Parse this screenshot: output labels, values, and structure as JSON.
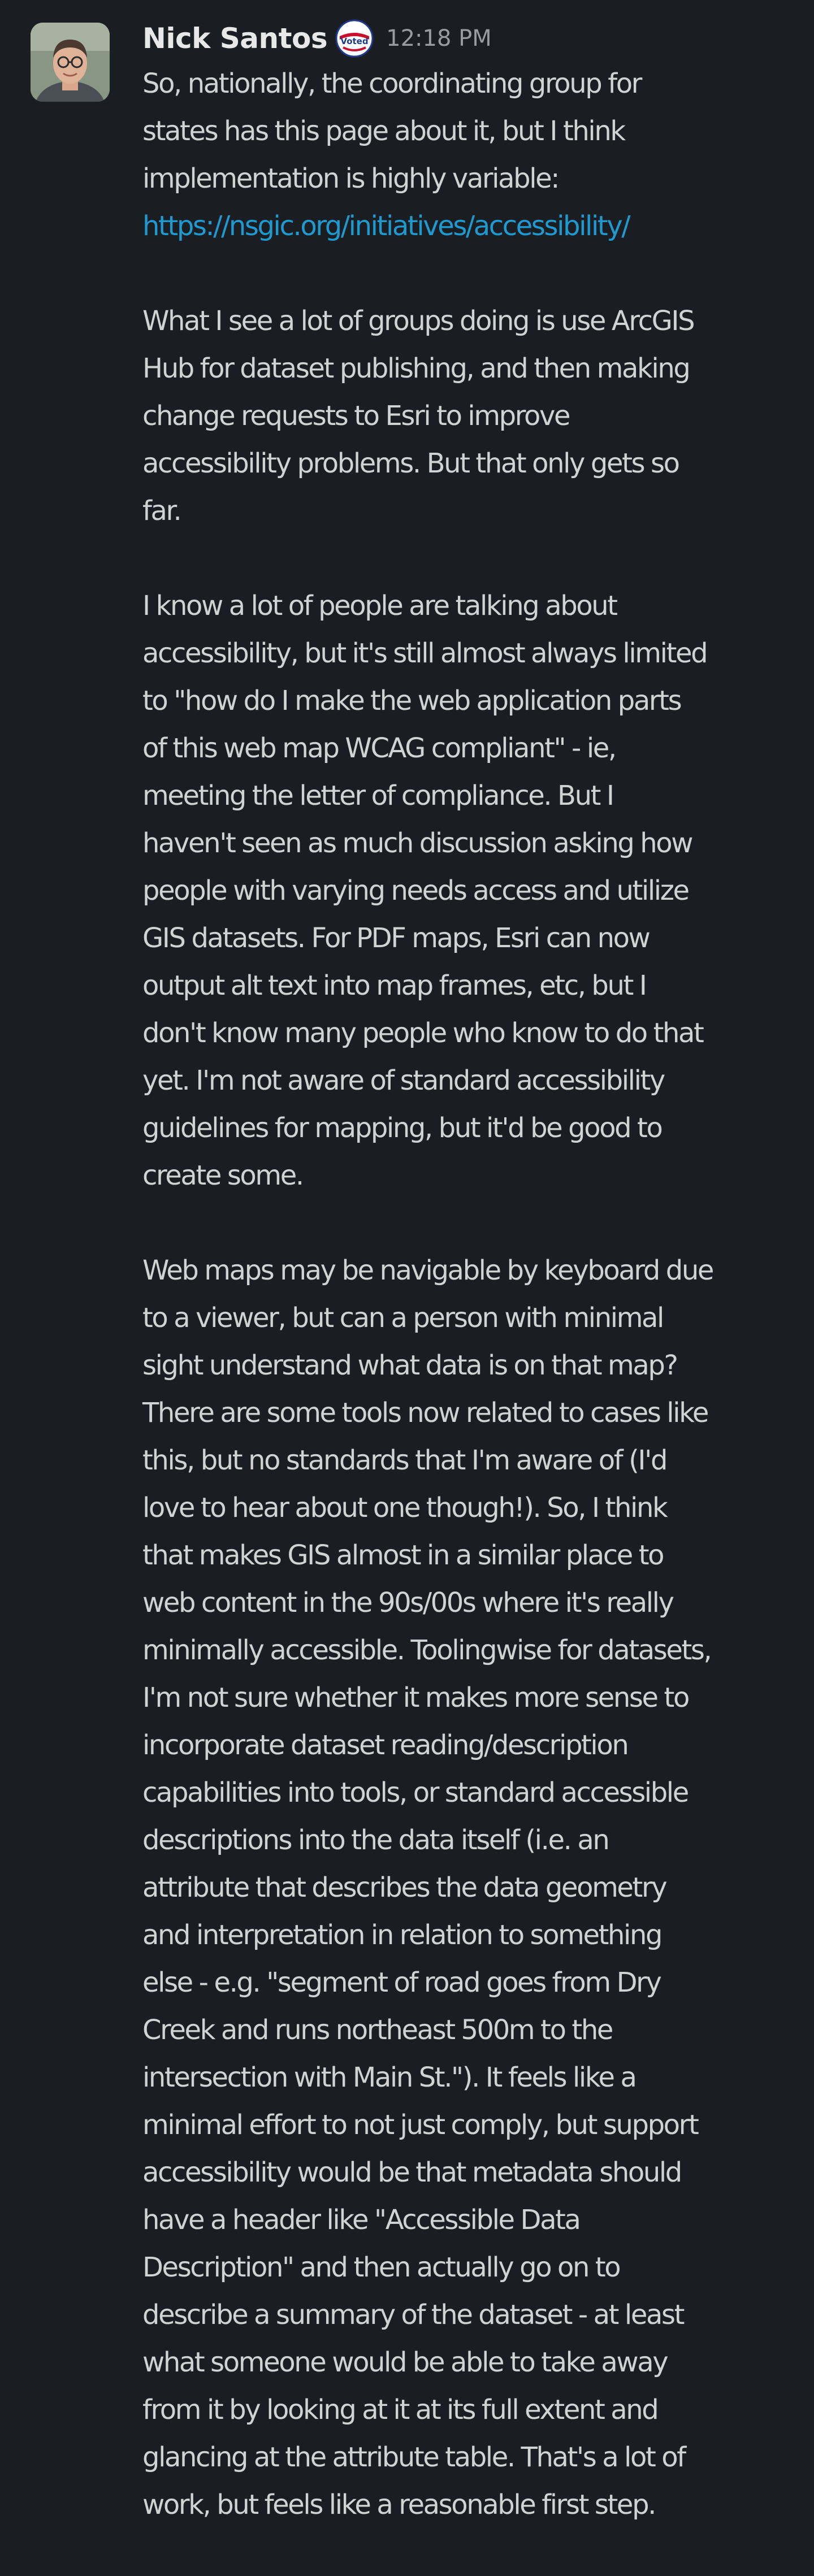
{
  "message": {
    "sender": "Nick Santos",
    "status_emoji": "voted-sticker-icon",
    "status_emoji_text": "Voted",
    "timestamp": "12:18 PM",
    "paragraph1_before_link": "So, nationally, the coordinating group for\nstates has this page about it, but I think\nimplementation is highly variable:",
    "link_text": "https://nsgic.org/initiatives/accessibility/",
    "paragraph2": "What I see a lot of groups doing is use ArcGIS\nHub for dataset publishing, and then making\nchange requests to Esri to improve\naccessibility problems. But that only gets so\nfar.",
    "paragraph3": "I know a lot of people are talking about\naccessibility, but it's still almost always limited\nto \"how do I make the web application parts\nof this web map WCAG compliant\" - ie,\nmeeting the letter of compliance. But I\nhaven't seen as much discussion asking how\npeople with varying needs access and utilize\nGIS datasets. For PDF maps, Esri can now\noutput alt text into map frames, etc, but I\ndon't know many people who know to do that\nyet. I'm not aware of standard accessibility\nguidelines for mapping, but it'd be good to\ncreate some.",
    "paragraph4": "Web maps may be navigable by keyboard due\nto a viewer, but can a person with minimal\nsight understand what data is on that map?\nThere are some tools now related to cases like\nthis, but no standards that I'm aware of (I'd\nlove to hear about one though!). So, I think\nthat makes GIS almost in a similar place to\nweb content in the 90s/00s where it's really\nminimally accessible. Toolingwise for datasets,\nI'm not sure whether it makes more sense to\nincorporate dataset reading/description\ncapabilities into tools, or standard accessible\ndescriptions into the data itself (i.e. an\nattribute that describes the data geometry\nand interpretation in relation to something\nelse - e.g. \"segment of road goes from Dry\nCreek and runs northeast 500m to the\nintersection with Main St.\"). It feels like a\nminimal effort to not just comply, but support\naccessibility would be that metadata should\nhave a header like \"Accessible Data\nDescription\" and then actually go on to\ndescribe a summary of the dataset - at least\nwhat someone would be able to take away\nfrom it by looking at it at its full extent and\nglancing at the attribute table. That's a lot of\nwork, but feels like a reasonable first step."
  },
  "colors": {
    "background": "#1a1d21",
    "text": "#d1d2d3",
    "name": "#e8e8e8",
    "timestamp": "#9a9b9e",
    "link": "#1d9bd1"
  }
}
